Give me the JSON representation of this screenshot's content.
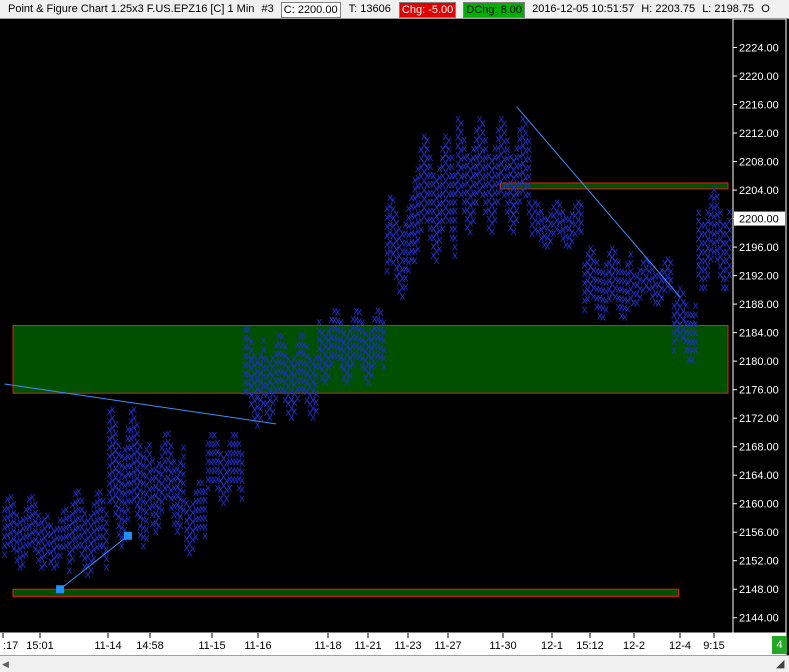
{
  "header": {
    "title": "Point & Figure Chart 1.25x3 F.US.EPZ16 [C]  1 Min",
    "hash": "#3",
    "close": "C: 2200.00",
    "trades": "T: 13606",
    "chg": "Chg: -5.00",
    "dchg": "DChg: 8.00",
    "timestamp": "2016-12-05 10:51:57",
    "high": "H: 2203.75",
    "low": "L: 2198.75",
    "trailing": "O"
  },
  "colors": {
    "background": "#000000",
    "x_marks": "#1f2fc8",
    "zone_fill": "#005000",
    "zone_border": "#e02020",
    "trendline": "#3a8fff",
    "marker": "#1e90ff",
    "axis_panel": "#ffffff"
  },
  "status": {
    "corner_badge": "4"
  },
  "chart_data": {
    "type": "point-and-figure",
    "symbol": "F.US.EPZ16",
    "box_size": 1.25,
    "reversal": 3,
    "interval": "1 Min",
    "ylim": [
      2142,
      2228
    ],
    "y_ticks": [
      2144,
      2148,
      2152,
      2156,
      2160,
      2164,
      2168,
      2172,
      2176,
      2180,
      2184,
      2188,
      2192,
      2196,
      2200,
      2204,
      2208,
      2212,
      2216,
      2220,
      2224
    ],
    "current_price": 2200.0,
    "x_labels": [
      ":17",
      "15:01",
      "11-14",
      "14:58",
      "11-15",
      "11-16",
      "11-18",
      "11-21",
      "11-23",
      "11-27",
      "11-30",
      "12-1",
      "15:12",
      "12-2",
      "12-4",
      "9:15"
    ],
    "column_range": [
      0,
      235
    ],
    "columns": [
      {
        "range": [
          0,
          13
        ],
        "price_low": 2151,
        "price_high": 2161.5
      },
      {
        "range": [
          14,
          20
        ],
        "price_low": 2151,
        "price_high": 2160
      },
      {
        "range": [
          21,
          33
        ],
        "price_low": 2150,
        "price_high": 2162
      },
      {
        "range": [
          34,
          46
        ],
        "price_low": 2154,
        "price_high": 2173.5
      },
      {
        "range": [
          47,
          58
        ],
        "price_low": 2156,
        "price_high": 2171
      },
      {
        "range": [
          59,
          65
        ],
        "price_low": 2153,
        "price_high": 2164
      },
      {
        "range": [
          66,
          77
        ],
        "price_low": 2160,
        "price_high": 2170
      },
      {
        "range": [
          78,
          84
        ],
        "price_low": 2171,
        "price_high": 2185
      },
      {
        "range": [
          85,
          101
        ],
        "price_low": 2172,
        "price_high": 2184
      },
      {
        "range": [
          102,
          123
        ],
        "price_low": 2177,
        "price_high": 2188
      },
      {
        "range": [
          124,
          132
        ],
        "price_low": 2189,
        "price_high": 2204
      },
      {
        "range": [
          133,
          146
        ],
        "price_low": 2194,
        "price_high": 2212
      },
      {
        "range": [
          147,
          170
        ],
        "price_low": 2198,
        "price_high": 2215
      },
      {
        "range": [
          171,
          187
        ],
        "price_low": 2196,
        "price_high": 2203
      },
      {
        "range": [
          188,
          203
        ],
        "price_low": 2186,
        "price_high": 2196
      },
      {
        "range": [
          204,
          216
        ],
        "price_low": 2188,
        "price_high": 2195
      },
      {
        "range": [
          217,
          224
        ],
        "price_low": 2180,
        "price_high": 2191
      },
      {
        "range": [
          225,
          235
        ],
        "price_low": 2190,
        "price_high": 2205
      }
    ],
    "zones": [
      {
        "name": "demand-zone-large",
        "price_top": 2185,
        "price_bottom": 2175.5,
        "col_start": 0,
        "col_end": 235
      },
      {
        "name": "demand-zone-low",
        "price_top": 2148,
        "price_bottom": 2147,
        "col_start": 0,
        "col_end": 219
      },
      {
        "name": "supply-zone-high",
        "price_top": 2205,
        "price_bottom": 2204.3,
        "col_start": 158,
        "col_end": 235
      }
    ],
    "trendlines": [
      {
        "name": "downtrend-line-left",
        "from": [
          0,
          2176.8
        ],
        "to": [
          88,
          2171.2
        ]
      },
      {
        "name": "uptrend-line-bottom",
        "from": [
          18,
          2148
        ],
        "to": [
          40,
          2155.5
        ]
      },
      {
        "name": "downtrend-line-right",
        "from": [
          166,
          2215.7
        ],
        "to": [
          219,
          2189
        ]
      }
    ],
    "markers": [
      {
        "name": "marker-low",
        "col": 18,
        "price": 2148
      },
      {
        "name": "marker-high",
        "col": 40,
        "price": 2155.5
      }
    ]
  }
}
